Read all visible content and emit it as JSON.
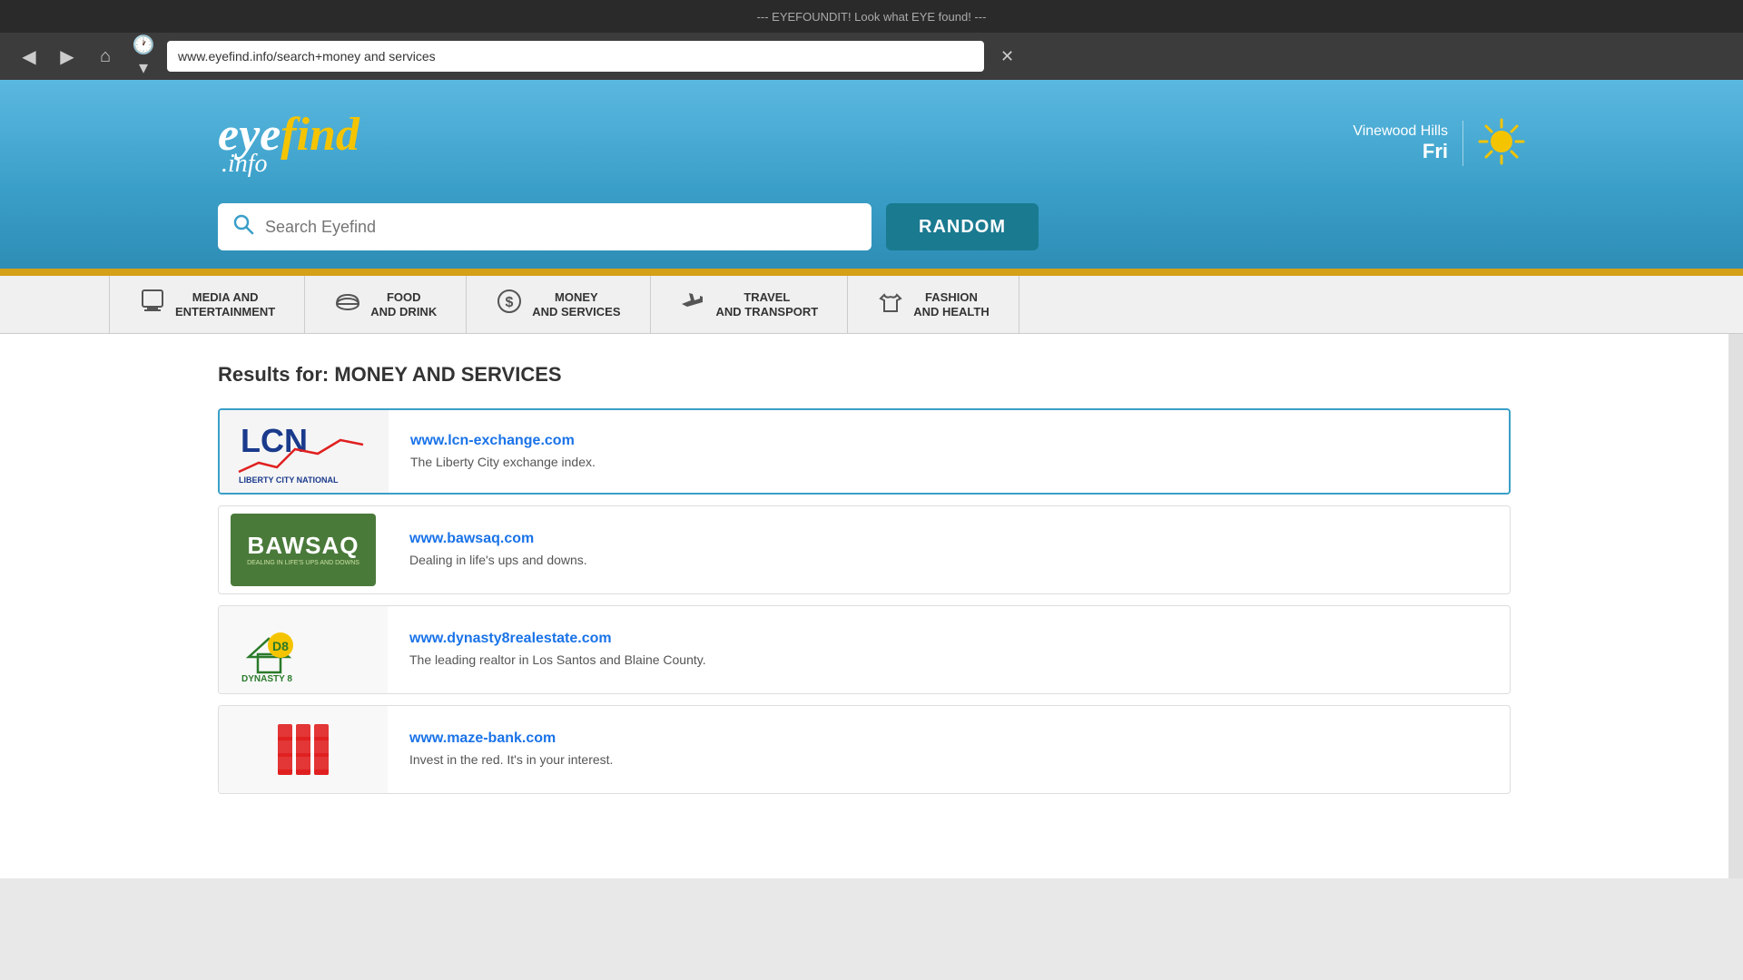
{
  "browser": {
    "top_message": "--- EYEFOUNDIT! Look what EYE found! ---",
    "url": "www.eyefind.info/search+money and services",
    "back_btn": "◀",
    "forward_btn": "▶",
    "home_btn": "⌂",
    "history_btn": "🕐",
    "close_btn": "✕"
  },
  "header": {
    "logo_eye": "eye",
    "logo_find": "find",
    "logo_info": ".info",
    "location": "Vinewood Hills",
    "day": "Fri",
    "weather": "sunny"
  },
  "search": {
    "placeholder": "Search Eyefind",
    "random_label": "RANDOM"
  },
  "nav_tabs": [
    {
      "id": "media",
      "icon": "📱",
      "line1": "MEDIA AND",
      "line2": "ENTERTAINMENT"
    },
    {
      "id": "food",
      "icon": "🍔",
      "line1": "FOOD",
      "line2": "AND DRINK"
    },
    {
      "id": "money",
      "icon": "💲",
      "line1": "MONEY",
      "line2": "AND SERVICES"
    },
    {
      "id": "travel",
      "icon": "✈",
      "line1": "TRAVEL",
      "line2": "AND TRANSPORT"
    },
    {
      "id": "fashion",
      "icon": "👜",
      "line1": "FASHION",
      "line2": "AND HEALTH"
    }
  ],
  "results": {
    "title": "Results for: MONEY AND SERVICES",
    "items": [
      {
        "id": "lcn",
        "url": "www.lcn-exchange.com",
        "desc": "The Liberty City exchange index.",
        "highlighted": true
      },
      {
        "id": "bawsaq",
        "url": "www.bawsaq.com",
        "desc": "Dealing in life's ups and downs.",
        "highlighted": false
      },
      {
        "id": "dynasty8",
        "url": "www.dynasty8realestate.com",
        "desc": "The leading realtor in Los Santos and Blaine County.",
        "highlighted": false
      },
      {
        "id": "mazebank",
        "url": "www.maze-bank.com",
        "desc": "Invest in the red. It's in your interest.",
        "highlighted": false
      }
    ]
  }
}
